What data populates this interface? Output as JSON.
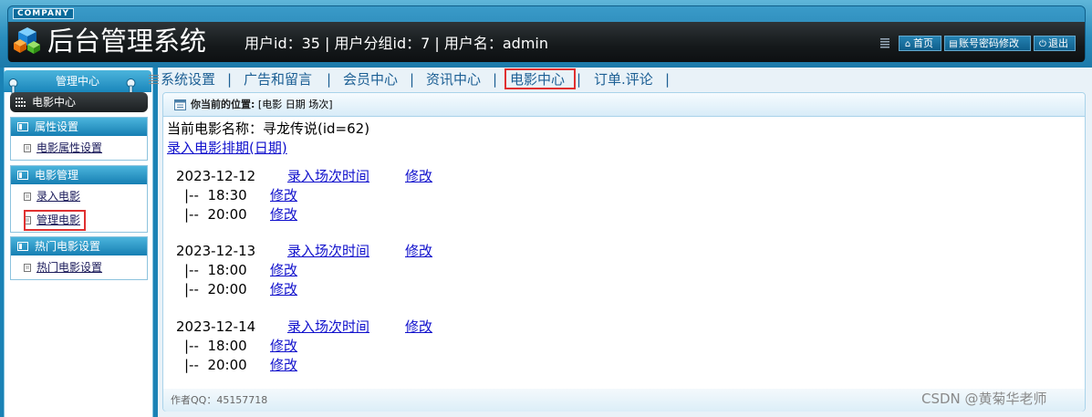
{
  "header": {
    "company": "COMPANY",
    "title": "后台管理系统",
    "user_info": "用户id：35 | 用户分组id：7 | 用户名：admin",
    "buttons": {
      "home": "首页",
      "password": "账号密码修改",
      "logout": "退出"
    }
  },
  "sidebar": {
    "header": "管理中心",
    "current": "电影中心",
    "sections": [
      {
        "title": "属性设置",
        "items": [
          {
            "label": "电影属性设置"
          }
        ]
      },
      {
        "title": "电影管理",
        "items": [
          {
            "label": "录入电影"
          },
          {
            "label": "管理电影"
          }
        ]
      },
      {
        "title": "热门电影设置",
        "items": [
          {
            "label": "热门电影设置"
          }
        ]
      }
    ]
  },
  "topnav": {
    "items": [
      "系统设置",
      "广告和留言",
      "会员中心",
      "资讯中心",
      "电影中心",
      "订单.评论"
    ],
    "active": "电影中心"
  },
  "content": {
    "crumb_label": "你当前的位置:",
    "crumb_value": "[电影 日期 场次]",
    "movie_name": "当前电影名称：寻龙传说(id=62)",
    "add_schedule_link": "录入电影排期(日期)",
    "schedule": [
      {
        "date": "2023-12-12",
        "add_link": "录入场次时间",
        "edit_link": "修改",
        "times": [
          {
            "prefix": "|--",
            "time": "18:30",
            "edit": "修改"
          },
          {
            "prefix": "|--",
            "time": "20:00",
            "edit": "修改"
          }
        ]
      },
      {
        "date": "2023-12-13",
        "add_link": "录入场次时间",
        "edit_link": "修改",
        "times": [
          {
            "prefix": "|--",
            "time": "18:00",
            "edit": "修改"
          },
          {
            "prefix": "|--",
            "time": "20:00",
            "edit": "修改"
          }
        ]
      },
      {
        "date": "2023-12-14",
        "add_link": "录入场次时间",
        "edit_link": "修改",
        "times": [
          {
            "prefix": "|--",
            "time": "18:00",
            "edit": "修改"
          },
          {
            "prefix": "|--",
            "time": "20:00",
            "edit": "修改"
          }
        ]
      }
    ],
    "footer": "作者QQ：45157718"
  },
  "watermark": "CSDN @黄菊华老师",
  "colors": {
    "header_blue": "#2a8dbd",
    "header_dark": "#15191b",
    "link": "#1010cc",
    "highlight_box": "#e03030"
  }
}
